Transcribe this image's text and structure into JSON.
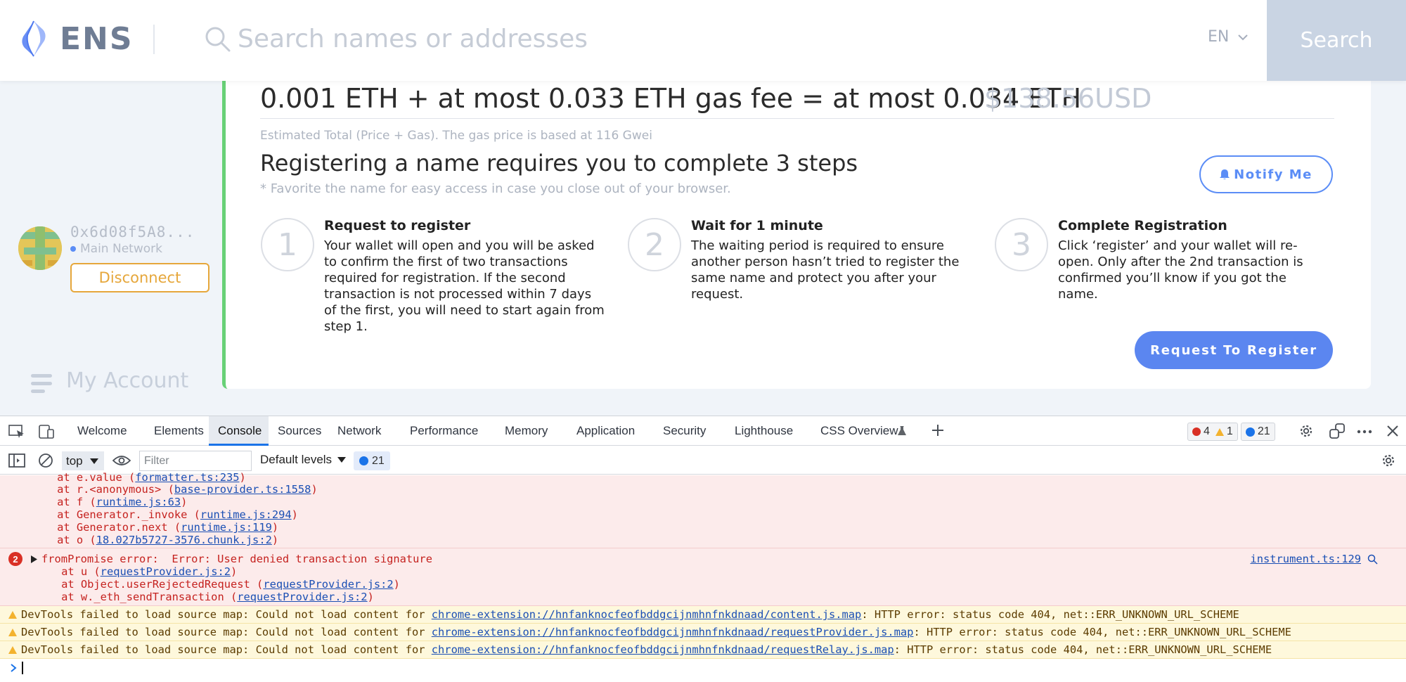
{
  "header": {
    "logo_text": "ENS",
    "search_placeholder": "Search names or addresses",
    "language": "EN",
    "search_button": "Search"
  },
  "sidebar": {
    "address": "0x6d08f5A8...",
    "network": "Main Network",
    "disconnect_label": "Disconnect",
    "my_account_label": "My Account"
  },
  "registration": {
    "price_line": "0.001 ETH + at most 0.033 ETH gas fee = at most 0.034 ETH",
    "usd_price": "$138.56USD",
    "estimate_note": "Estimated Total (Price + Gas). The gas price is based at 116 Gwei",
    "steps_title": "Registering a name requires you to complete 3 steps",
    "favorite_note": "* Favorite the name for easy access in case you close out of your browser.",
    "notify_label": "Notify Me",
    "steps": [
      {
        "number": "1",
        "title": "Request to register",
        "description": "Your wallet will open and you will be asked to confirm the first of two transactions required for registration. If the second transaction is not processed within 7 days of the first, you will need to start again from step 1."
      },
      {
        "number": "2",
        "title": "Wait for 1 minute",
        "description": "The waiting period is required to ensure another person hasn’t tried to register the same name and protect you after your request."
      },
      {
        "number": "3",
        "title": "Complete Registration",
        "description": "Click ‘register’ and your wallet will re-open. Only after the 2nd transaction is confirmed you’ll know if you got the name."
      }
    ],
    "register_button": "Request To Register"
  },
  "devtools": {
    "tabs": [
      "Welcome",
      "Elements",
      "Console",
      "Sources",
      "Network",
      "Performance",
      "Memory",
      "Application",
      "Security",
      "Lighthouse",
      "CSS Overview"
    ],
    "active_tab": "Console",
    "error_count": "4",
    "warning_count": "1",
    "message_count": "21",
    "context": "top",
    "filter_placeholder": "Filter",
    "levels": "Default levels",
    "stack_frames_1": [
      {
        "prefix": "    at e.value (",
        "link": "formatter.ts:235",
        "suffix": ")"
      },
      {
        "prefix": "    at r.<anonymous> (",
        "link": "base-provider.ts:1558",
        "suffix": ")"
      },
      {
        "prefix": "    at f (",
        "link": "runtime.js:63",
        "suffix": ")"
      },
      {
        "prefix": "    at Generator._invoke (",
        "link": "runtime.js:294",
        "suffix": ")"
      },
      {
        "prefix": "    at Generator.next (",
        "link": "runtime.js:119",
        "suffix": ")"
      },
      {
        "prefix": "    at o (",
        "link": "18.027b5727-3576.chunk.js:2",
        "suffix": ")"
      }
    ],
    "error_group": {
      "repeat_count": "2",
      "message": "fromPromise error:  Error: User denied transaction signature",
      "source": "instrument.ts:129",
      "frames": [
        {
          "prefix": "    at u (",
          "link": "requestProvider.js:2",
          "suffix": ")"
        },
        {
          "prefix": "    at Object.userRejectedRequest (",
          "link": "requestProvider.js:2",
          "suffix": ")"
        },
        {
          "prefix": "    at w._eth_sendTransaction (",
          "link": "requestProvider.js:2",
          "suffix": ")"
        }
      ]
    },
    "warnings": [
      {
        "prefix": "DevTools failed to load source map: Could not load content for ",
        "link": "chrome-extension://hnfanknocfeofbddgcijnmhnfnkdnaad/content.js.map",
        "suffix": ": HTTP error: status code 404, net::ERR_UNKNOWN_URL_SCHEME"
      },
      {
        "prefix": "DevTools failed to load source map: Could not load content for ",
        "link": "chrome-extension://hnfanknocfeofbddgcijnmhnfnkdnaad/requestProvider.js.map",
        "suffix": ": HTTP error: status code 404, net::ERR_UNKNOWN_URL_SCHEME"
      },
      {
        "prefix": "DevTools failed to load source map: Could not load content for ",
        "link": "chrome-extension://hnfanknocfeofbddgcijnmhnfnkdnaad/requestRelay.js.map",
        "suffix": ": HTTP error: status code 404, net::ERR_UNKNOWN_URL_SCHEME"
      }
    ]
  }
}
